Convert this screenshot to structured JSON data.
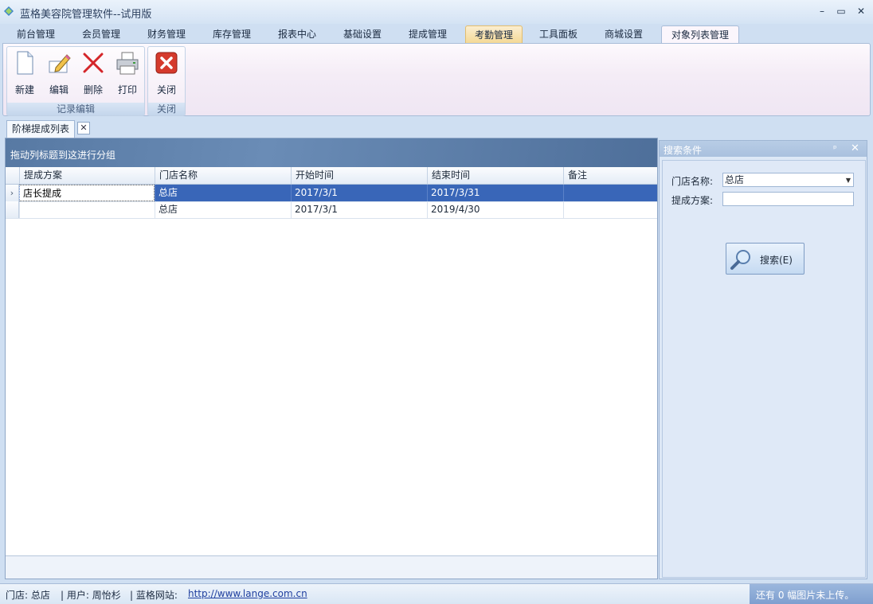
{
  "window": {
    "title": "蓝格美容院管理软件--试用版",
    "minimize": "–",
    "maximize": "▭",
    "close": "✕"
  },
  "menu_tabs": [
    "前台管理",
    "会员管理",
    "财务管理",
    "库存管理",
    "报表中心",
    "基础设置",
    "提成管理",
    "考勤管理",
    "工具面板",
    "商城设置",
    "对象列表管理"
  ],
  "ribbon": {
    "buttons": {
      "new": "新建",
      "edit": "编辑",
      "delete": "删除",
      "print": "打印",
      "close": "关闭"
    },
    "groups": {
      "record_edit": "记录编辑",
      "close": "关闭"
    }
  },
  "doc_tab": {
    "title": "阶梯提成列表",
    "close": "✕"
  },
  "grid": {
    "group_hint": "拖动列标题到这进行分组",
    "columns": [
      "提成方案",
      "门店名称",
      "开始时间",
      "结束时间",
      "备注"
    ],
    "rows": [
      {
        "scheme": "店长提成",
        "store": "总店",
        "start": "2017/3/1",
        "end": "2017/3/31",
        "note": ""
      },
      {
        "scheme": "",
        "store": "总店",
        "start": "2017/3/1",
        "end": "2019/4/30",
        "note": ""
      }
    ],
    "row_indicator": "›"
  },
  "search_panel": {
    "title": "搜索条件",
    "pin": "ᵖ",
    "close": "✕",
    "store_label": "门店名称:",
    "store_value": "总店",
    "scheme_label": "提成方案:",
    "scheme_value": "",
    "search_button": "搜索(E)"
  },
  "statusbar": {
    "store": "门店: 总店",
    "user": "| 用户: 周怡杉",
    "site_label": "| 蓝格网站:",
    "site_url": "http://www.lange.com.cn",
    "upload_notice": "还有 0 幅图片未上传。"
  }
}
